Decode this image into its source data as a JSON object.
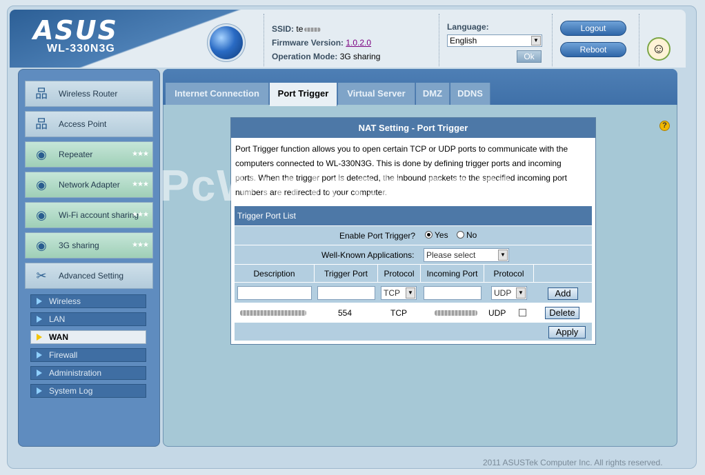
{
  "header": {
    "brand": "ASUS",
    "model": "WL-330N3G",
    "ssid_label": "SSID:",
    "ssid_value": "te",
    "firmware_label": "Firmware Version:",
    "firmware_value": "1.0.2.0",
    "mode_label": "Operation Mode:",
    "mode_value": "3G sharing",
    "language_label": "Language:",
    "language_value": "English",
    "ok_label": "Ok",
    "logout_label": "Logout",
    "reboot_label": "Reboot"
  },
  "sidebar": {
    "items": [
      {
        "label": "Wireless Router",
        "icon": "network-icon"
      },
      {
        "label": "Access Point",
        "icon": "network-icon"
      },
      {
        "label": "Repeater",
        "icon": "router-icon"
      },
      {
        "label": "Network Adapter",
        "icon": "router-icon"
      },
      {
        "label": "Wi-Fi account sharing",
        "icon": "router-icon"
      },
      {
        "label": "3G sharing",
        "icon": "router-icon"
      },
      {
        "label": "Advanced Setting",
        "icon": "tools-icon"
      }
    ],
    "sub_items": [
      "Wireless",
      "LAN",
      "WAN",
      "Firewall",
      "Administration",
      "System Log"
    ]
  },
  "tabs": [
    "Internet Connection",
    "Port Trigger",
    "Virtual Server",
    "DMZ",
    "DDNS"
  ],
  "panel": {
    "title": "NAT Setting - Port Trigger",
    "description": "Port Trigger function allows you to open certain TCP or UDP ports to communicate with the computers connected to WL-330N3G. This is done by defining trigger ports and incoming ports. When the trigger port is detected, the inbound packets to the specified incoming port numbers are redirected to your computer.",
    "list_title": "Trigger Port List",
    "enable_label": "Enable Port Trigger?",
    "yes_label": "Yes",
    "no_label": "No",
    "apps_label": "Well-Known Applications:",
    "apps_placeholder": "Please select",
    "columns": [
      "Description",
      "Trigger Port",
      "Protocol",
      "Incoming Port",
      "Protocol"
    ],
    "new_row": {
      "protocol1": "TCP",
      "protocol2": "UDP",
      "add_label": "Add"
    },
    "entry": {
      "trigger_port": "554",
      "protocol1": "TCP",
      "protocol2": "UDP",
      "delete_label": "Delete"
    },
    "apply_label": "Apply"
  },
  "watermark": "PcWinTech.com",
  "footer": "2011 ASUSTek Computer Inc. All rights reserved."
}
